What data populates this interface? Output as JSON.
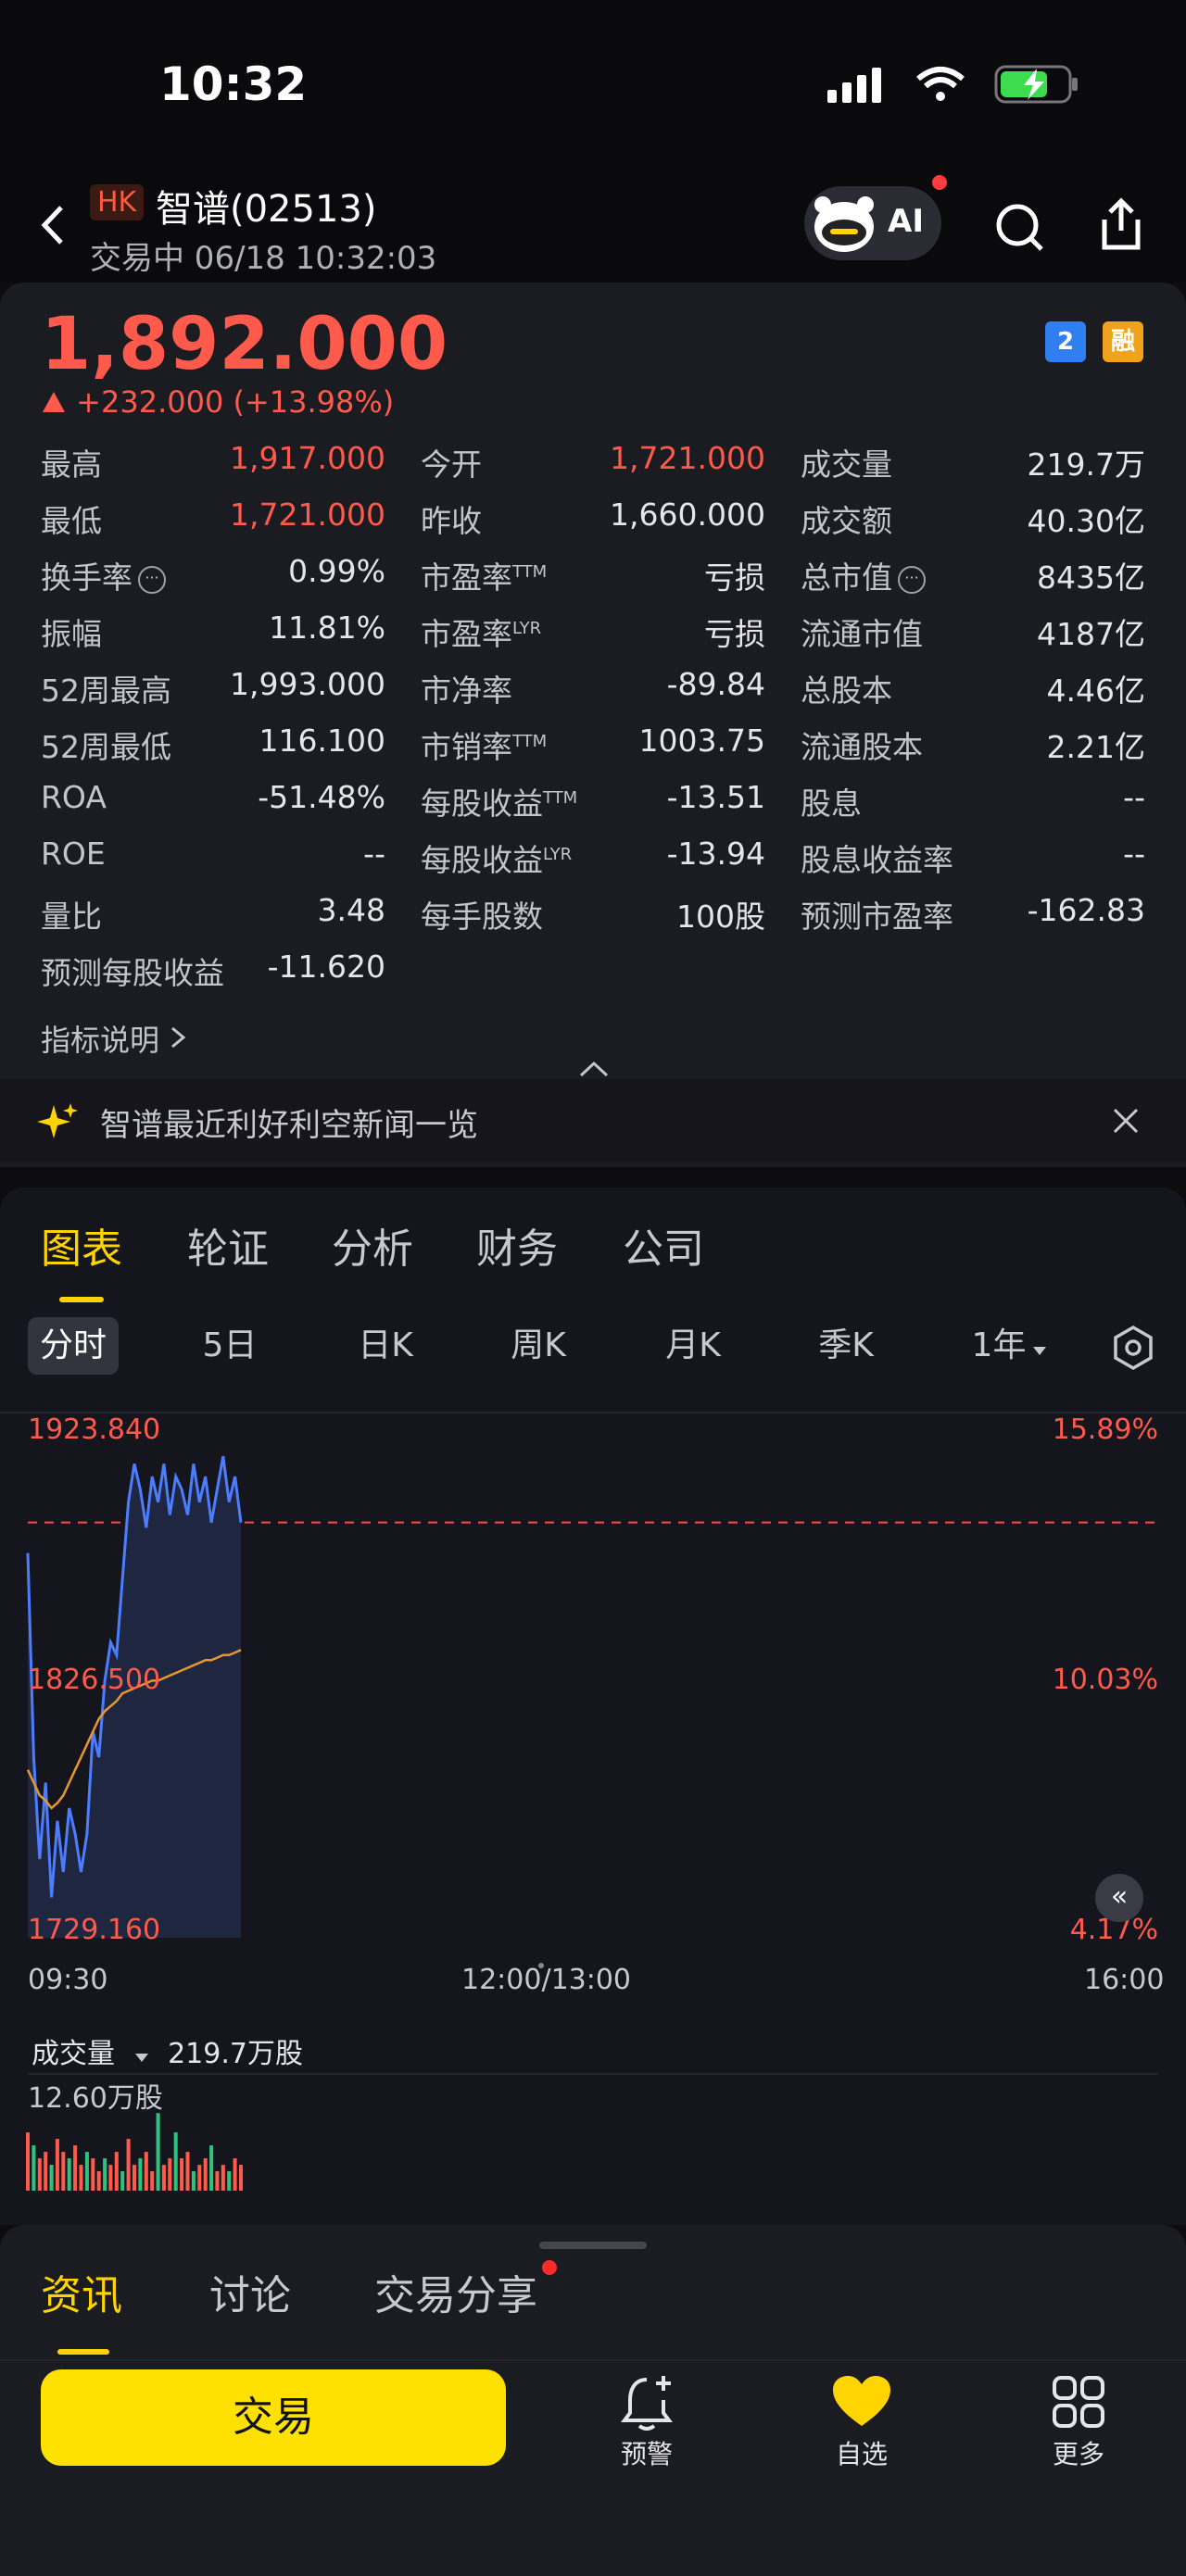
{
  "status": {
    "time": "10:32"
  },
  "header": {
    "market": "HK",
    "name": "智谱(02513)",
    "subtitle": "交易中 06/18 10:32:03",
    "ai_label": "AI"
  },
  "quote": {
    "price": "1,892.000",
    "change": "+232.000 (+13.98%)",
    "badges": [
      "2",
      "融"
    ],
    "rows": [
      [
        [
          "最高",
          "1,917.000",
          true
        ],
        [
          "今开",
          "1,721.000",
          true
        ],
        [
          "成交量",
          "219.7万",
          false
        ]
      ],
      [
        [
          "最低",
          "1,721.000",
          true
        ],
        [
          "昨收",
          "1,660.000",
          false
        ],
        [
          "成交额",
          "40.30亿",
          false
        ]
      ],
      [
        [
          "换手率",
          "0.99%",
          false
        ],
        [
          "市盈率",
          "亏损",
          false
        ],
        [
          "总市值",
          "8435亿",
          false
        ]
      ],
      [
        [
          "振幅",
          "11.81%",
          false
        ],
        [
          "市盈率",
          "亏损",
          false
        ],
        [
          "流通市值",
          "4187亿",
          false
        ]
      ],
      [
        [
          "52周最高",
          "1,993.000",
          false
        ],
        [
          "市净率",
          "-89.84",
          false
        ],
        [
          "总股本",
          "4.46亿",
          false
        ]
      ],
      [
        [
          "52周最低",
          "116.100",
          false
        ],
        [
          "市销率",
          "1003.75",
          false
        ],
        [
          "流通股本",
          "2.21亿",
          false
        ]
      ],
      [
        [
          "ROA",
          "-51.48%",
          false
        ],
        [
          "每股收益",
          "-13.51",
          false
        ],
        [
          "股息",
          "--",
          false
        ]
      ],
      [
        [
          "ROE",
          "--",
          false
        ],
        [
          "每股收益",
          "-13.94",
          false
        ],
        [
          "股息收益率",
          "--",
          false
        ]
      ],
      [
        [
          "量比",
          "3.48",
          false
        ],
        [
          "每手股数",
          "100股",
          false
        ],
        [
          "预测市盈率",
          "-162.83",
          false
        ]
      ],
      [
        [
          "预测每股收益",
          "-11.620",
          false
        ]
      ]
    ],
    "sup": {
      "ttm": "TTM",
      "lyr": "LYR"
    },
    "indicator_link": "指标说明",
    "news": "智谱最近利好利空新闻一览"
  },
  "tabs": [
    "图表",
    "轮证",
    "分析",
    "财务",
    "公司"
  ],
  "ktabs": [
    "分时",
    "5日",
    "日K",
    "周K",
    "月K",
    "季K",
    "1年"
  ],
  "chart": {
    "y_labels": [
      "1923.840",
      "1826.500",
      "1729.160"
    ],
    "pct_labels": [
      "15.89%",
      "10.03%",
      "4.17%"
    ],
    "x_labels": [
      "09:30",
      "12:00/13:00",
      "16:00"
    ],
    "volume_label": "成交量",
    "volume_value": "219.7万股",
    "volume_max": "12.60万股"
  },
  "chart_data": {
    "type": "line",
    "x_range": [
      "09:30",
      "16:00"
    ],
    "y_range": [
      1729.16,
      1923.84
    ],
    "prev_close": 1892.0,
    "series": [
      {
        "name": "price",
        "values": [
          1880,
          1800,
          1760,
          1790,
          1745,
          1775,
          1755,
          1780,
          1770,
          1755,
          1770,
          1810,
          1800,
          1830,
          1845,
          1840,
          1870,
          1900,
          1915,
          1905,
          1890,
          1910,
          1900,
          1915,
          1895,
          1910,
          1905,
          1895,
          1915,
          1900,
          1910,
          1892,
          1905,
          1918,
          1900,
          1910,
          1892
        ]
      },
      {
        "name": "avg",
        "values": [
          1795,
          1790,
          1785,
          1783,
          1780,
          1782,
          1785,
          1790,
          1795,
          1800,
          1805,
          1810,
          1815,
          1818,
          1820,
          1822,
          1825,
          1826,
          1827,
          1828,
          1829,
          1830,
          1830,
          1831,
          1832,
          1833,
          1834,
          1835,
          1836,
          1837,
          1838,
          1838,
          1839,
          1840,
          1840,
          1841,
          1842
        ]
      }
    ],
    "volume": [
      9,
      7,
      5,
      6,
      4,
      8,
      6,
      5,
      7,
      4,
      6,
      5,
      3,
      5,
      4,
      6,
      3,
      8,
      4,
      5,
      6,
      3,
      12,
      4,
      5,
      9,
      5,
      6,
      3,
      4,
      5,
      7,
      3,
      4,
      3,
      5,
      4
    ]
  },
  "bottom": {
    "tabs": [
      "资讯",
      "讨论",
      "交易分享"
    ],
    "trade": "交易",
    "tools": [
      "预警",
      "自选",
      "更多"
    ]
  }
}
